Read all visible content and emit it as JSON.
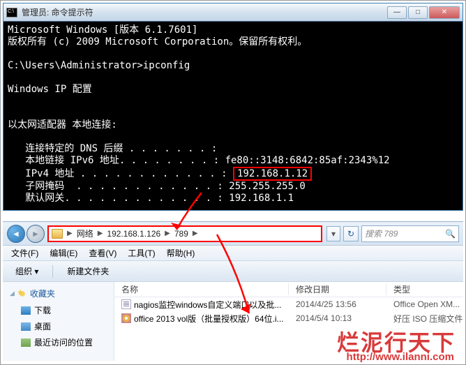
{
  "cmd": {
    "title": "管理员: 命令提示符",
    "lines_pre": "Microsoft Windows [版本 6.1.7601]\n版权所有 (c) 2009 Microsoft Corporation。保留所有权利。\n\nC:\\Users\\Administrator>ipconfig\n\nWindows IP 配置\n\n\n以太网适配器 本地连接:\n\n   连接特定的 DNS 后缀 . . . . . . . :\n   本地链接 IPv6 地址. . . . . . . . : fe80::3148:6842:85af:2343%12",
    "ipv4_label": "   IPv4 地址 . . . . . . . . . . . . : ",
    "ipv4_value": "192.168.1.12",
    "lines_post": "   子网掩码  . . . . . . . . . . . . : 255.255.255.0\n   默认网关. . . . . . . . . . . . . : 192.168.1.1"
  },
  "explorer": {
    "breadcrumb": {
      "root": "网络",
      "host": "192.168.1.126",
      "folder": "789"
    },
    "search_placeholder": "搜索 789",
    "menu": {
      "file": "文件(F)",
      "edit": "编辑(E)",
      "view": "查看(V)",
      "tools": "工具(T)",
      "help": "帮助(H)"
    },
    "toolbar": {
      "organize": "组织 ▾",
      "newfolder": "新建文件夹"
    },
    "sidebar": {
      "favorites": "收藏夹",
      "downloads": "下载",
      "desktop": "桌面",
      "recent": "最近访问的位置"
    },
    "columns": {
      "name": "名称",
      "date": "修改日期",
      "type": "类型"
    },
    "files": [
      {
        "name": "nagios监控windows自定义端口以及批...",
        "date": "2014/4/25 13:56",
        "type": "Office Open XM..."
      },
      {
        "name": "office 2013 vol版（批量授权版）64位.i...",
        "date": "2014/5/4 10:13",
        "type": "好压 ISO 压缩文件"
      }
    ]
  },
  "watermark": {
    "text": "烂泥行天下",
    "url": "http://www.ilanni.com"
  }
}
